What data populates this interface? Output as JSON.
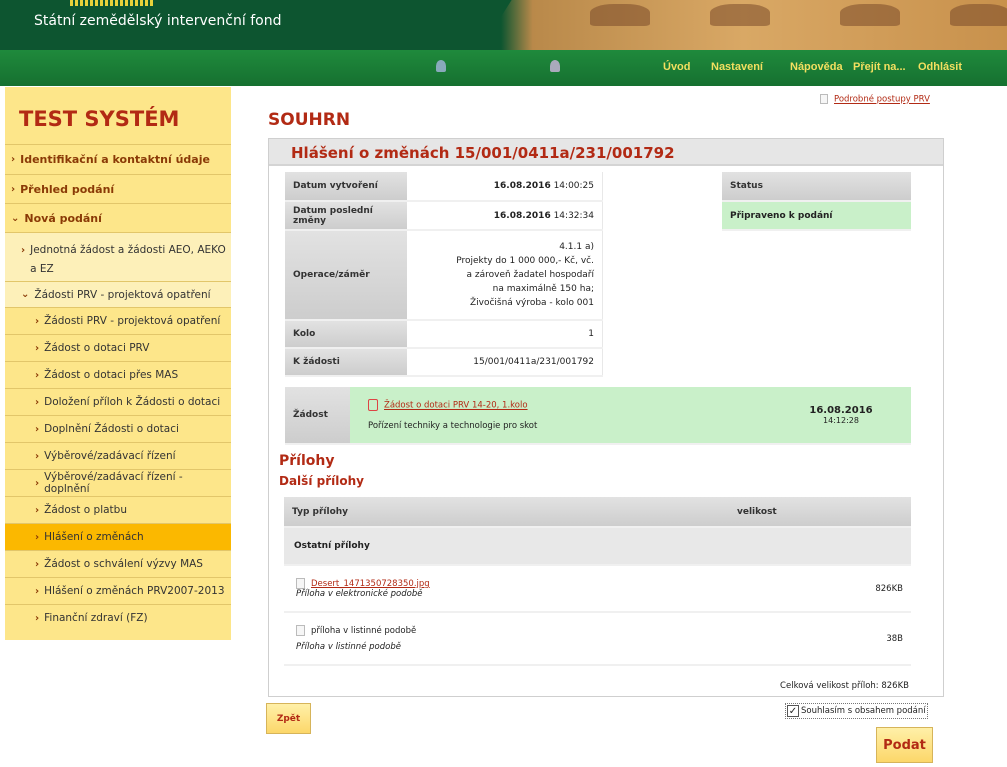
{
  "header": {
    "org_name": "Státní zemědělský intervenční fond"
  },
  "nav": {
    "items": [
      "Úvod",
      "Nastavení",
      "Nápověda",
      "Přejít na...",
      "Odhlásit"
    ]
  },
  "sidebar": {
    "title": "TEST SYSTÉM",
    "items": [
      {
        "label": "Identifikační a kontaktní údaje",
        "level": 0,
        "expanded": false
      },
      {
        "label": "Přehled podání",
        "level": 0,
        "expanded": false
      },
      {
        "label": "Nová podání",
        "level": 0,
        "expanded": true
      },
      {
        "label": "Jednotná žádost a žádosti AEO, AEKO a EZ",
        "level": 1,
        "expanded": false
      },
      {
        "label": "Žádosti PRV - projektová opatření",
        "level": 1,
        "expanded": true
      },
      {
        "label": "Žádosti PRV - projektová opatření",
        "level": 2
      },
      {
        "label": "Žádost o dotaci PRV",
        "level": 2
      },
      {
        "label": "Žádost o dotaci přes MAS",
        "level": 2
      },
      {
        "label": "Doložení příloh k Žádosti o dotaci",
        "level": 2
      },
      {
        "label": "Doplnění Žádosti o dotaci",
        "level": 2
      },
      {
        "label": "Výběrové/zadávací řízení",
        "level": 2
      },
      {
        "label": "Výběrové/zadávací řízení - doplnění",
        "level": 2
      },
      {
        "label": "Žádost o platbu",
        "level": 2
      },
      {
        "label": "Hlášení o změnách",
        "level": 2,
        "active": true
      },
      {
        "label": "Žádost o schválení výzvy MAS",
        "level": 2
      },
      {
        "label": "Hlášení o změnách PRV2007-2013",
        "level": 2
      },
      {
        "label": "Finanční zdraví (FZ)",
        "level": 2
      }
    ]
  },
  "main": {
    "help_link": "Podrobné postupy PRV",
    "page_title": "SOUHRN",
    "panel_title": "Hlášení o změnách 15/001/0411a/231/001792",
    "info": {
      "created_label": "Datum vytvoření",
      "created_date": "16.08.2016",
      "created_time": "14:00:25",
      "changed_label": "Datum poslední změny",
      "changed_date": "16.08.2016",
      "changed_time": "14:32:34",
      "operation_label": "Operace/záměr",
      "operation_lines": [
        "4.1.1 a)",
        "Projekty do 1 000 000,- Kč, vč.",
        "a zároveň žadatel hospodaří",
        "na maximálně 150 ha;",
        "Živočišná výroba - kolo 001"
      ],
      "round_label": "Kolo",
      "round_value": "1",
      "request_label": "K žádosti",
      "request_value": "15/001/0411a/231/001792"
    },
    "status": {
      "label": "Status",
      "value": "Připraveno k podání"
    },
    "zadost": {
      "label": "Žádost",
      "link": "Žádost o dotaci PRV 14-20, 1.kolo",
      "description": "Pořízení techniky a technologie pro skot",
      "date": "16.08.2016",
      "time": "14:12:28"
    },
    "attachments": {
      "title": "Přílohy",
      "subtitle": "Další přílohy",
      "col_type": "Typ přílohy",
      "col_size": "velikost",
      "group": "Ostatní přílohy",
      "rows": [
        {
          "name": "Desert_1471350728350.jpg",
          "type": "Příloha v elektronické podobě",
          "size": "826KB",
          "link": true
        },
        {
          "name": "příloha v listinné podobě",
          "type": "Příloha v listinné podobě",
          "size": "38B",
          "link": false
        }
      ],
      "total": "Celková velikost příloh: 826KB"
    },
    "back_button": "Zpět",
    "agree_label": "Souhlasím s obsahem podání",
    "agree_checked": true,
    "submit_button": "Podat"
  }
}
